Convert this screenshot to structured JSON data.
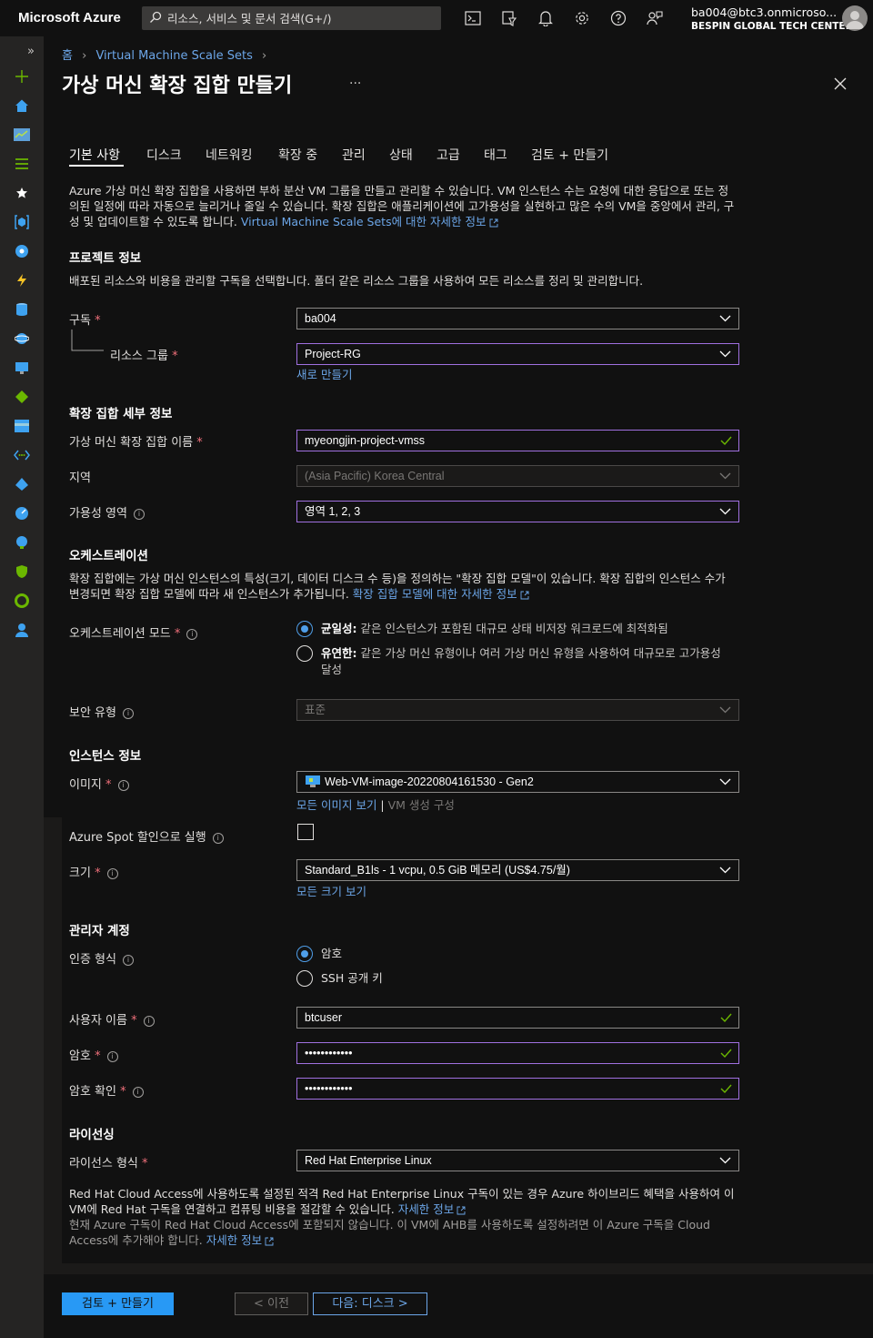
{
  "topbar": {
    "brand": "Microsoft Azure",
    "search_placeholder": "리소스, 서비스 및 문서 검색(G+/)",
    "account_name": "ba004@btc3.onmicroso...",
    "account_org": "BESPIN GLOBAL TECH CENTE..."
  },
  "breadcrumb": {
    "home": "홈",
    "parent": "Virtual Machine Scale Sets"
  },
  "page": {
    "title": "가상 머신 확장 집합 만들기",
    "more": "···"
  },
  "tabs": [
    "기본 사항",
    "디스크",
    "네트워킹",
    "확장 중",
    "관리",
    "상태",
    "고급",
    "태그",
    "검토 + 만들기"
  ],
  "intro": {
    "text": "Azure 가상 머신 확장 집합을 사용하면 부하 분산 VM 그룹을 만들고 관리할 수 있습니다. VM 인스턴스 수는 요청에 대한 응답으로 또는 정의된 일정에 따라 자동으로 늘리거나 줄일 수 있습니다. 확장 집합은 애플리케이션에 고가용성을 실현하고 많은 수의 VM을 중앙에서 관리, 구성 및 업데이트할 수 있도록 합니다. ",
    "link": "Virtual Machine Scale Sets에 대한 자세한 정보"
  },
  "project": {
    "heading": "프로젝트 정보",
    "desc": "배포된 리소스와 비용을 관리할 구독을 선택합니다. 폴더 같은 리소스 그룹을 사용하여 모든 리소스를 정리 및 관리합니다.",
    "subscription_label": "구독",
    "subscription_value": "ba004",
    "rg_label": "리소스 그룹",
    "rg_value": "Project-RG",
    "rg_new": "새로 만들기"
  },
  "scaleset": {
    "heading": "확장 집합 세부 정보",
    "name_label": "가상 머신 확장 집합 이름",
    "name_value": "myeongjin-project-vmss",
    "region_label": "지역",
    "region_value": "(Asia Pacific) Korea Central",
    "zone_label": "가용성 영역",
    "zone_value": "영역 1, 2, 3"
  },
  "orchestration": {
    "heading": "오케스트레이션",
    "desc": "확장 집합에는 가상 머신 인스턴스의 특성(크기, 데이터 디스크 수 등)을 정의하는 \"확장 집합 모델\"이 있습니다. 확장 집합의 인스턴스 수가 변경되면 확장 집합 모델에 따라 새 인스턴스가 추가됩니다. ",
    "desc_link": "확장 집합 모델에 대한 자세한 정보",
    "mode_label": "오케스트레이션 모드",
    "uniform_title": "균일성:",
    "uniform_desc": " 같은 인스턴스가 포함된 대규모 상태 비저장 워크로드에 최적화됨",
    "flexible_title": "유연한:",
    "flexible_desc": " 같은 가상 머신 유형이나 여러 가상 머신 유형을 사용하여 대규모로 고가용성 달성",
    "security_label": "보안 유형",
    "security_value": "표준"
  },
  "instance": {
    "heading": "인스턴스 정보",
    "image_label": "이미지",
    "image_value": "Web-VM-image-20220804161530 - Gen2",
    "image_link": "모든 이미지 보기",
    "image_sep": " | ",
    "image_config": "VM 생성 구성",
    "spot_label": "Azure Spot 할인으로 실행",
    "size_label": "크기",
    "size_value": "Standard_B1ls - 1 vcpu, 0.5 GiB 메모리 (US$4.75/월)",
    "size_link": "모든 크기 보기"
  },
  "admin": {
    "heading": "관리자 계정",
    "auth_label": "인증 형식",
    "auth_password": "암호",
    "auth_ssh": "SSH 공개 키",
    "user_label": "사용자 이름",
    "user_value": "btcuser",
    "pw_label": "암호",
    "pw_value": "••••••••••••",
    "pwc_label": "암호 확인",
    "pwc_value": "••••••••••••"
  },
  "licensing": {
    "heading": "라이선싱",
    "type_label": "라이선스 형식",
    "type_value": "Red Hat Enterprise Linux",
    "desc1": "Red Hat Cloud Access에 사용하도록 설정된 적격 Red Hat Enterprise Linux 구독이 있는 경우 Azure 하이브리드 혜택을 사용하여 이 VM에 Red Hat 구독을 연결하고 컴퓨팅 비용을 절감할 수 있습니다. ",
    "desc1_link": "자세한 정보",
    "desc2": "현재 Azure 구독이 Red Hat Cloud Access에 포함되지 않습니다. 이 VM에 AHB를 사용하도록 설정하려면 이 Azure 구독을 Cloud Access에 추가해야 합니다. ",
    "desc2_link": "자세한 정보"
  },
  "footer": {
    "review": "검토 + 만들기",
    "prev": "< 이전",
    "next": "다음: 디스크 >"
  },
  "required_mark": "*"
}
